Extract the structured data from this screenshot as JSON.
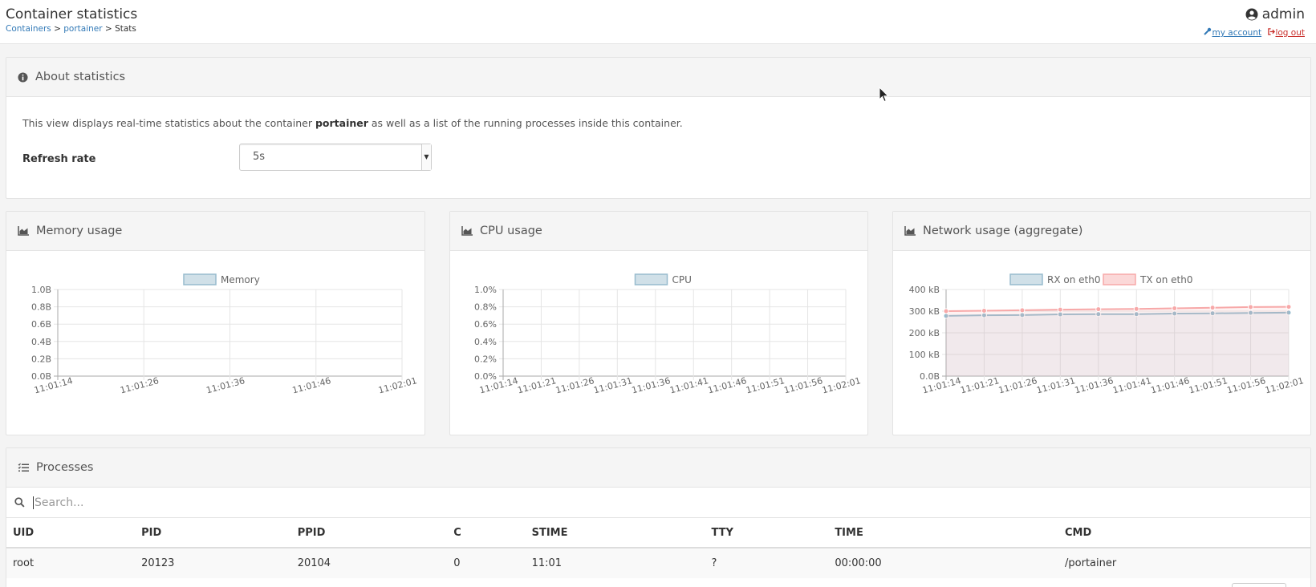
{
  "header": {
    "title": "Container statistics",
    "breadcrumb": {
      "item1": "Containers",
      "sep1": " > ",
      "item2": "portainer",
      "sep2": " > ",
      "current": "Stats"
    },
    "user": "admin",
    "my_account": "my account",
    "log_out": "log out"
  },
  "about": {
    "title": "About statistics",
    "text_prefix": "This view displays real-time statistics about the container ",
    "container_name": "portainer",
    "text_suffix": " as well as a list of the running processes inside this container.",
    "refresh_label": "Refresh rate",
    "refresh_value": "5s"
  },
  "memory": {
    "title": "Memory usage"
  },
  "cpu": {
    "title": "CPU usage"
  },
  "network": {
    "title": "Network usage (aggregate)"
  },
  "chart_data": [
    {
      "type": "line",
      "legend": [
        "Memory"
      ],
      "y_ticks": [
        "1.0B",
        "0.8B",
        "0.6B",
        "0.4B",
        "0.2B",
        "0.0B"
      ],
      "ylim": [
        0,
        1
      ],
      "x_ticks": [
        "11:01:14",
        "11:01:26",
        "11:01:36",
        "11:01:46",
        "11:02:01"
      ],
      "series": [
        {
          "name": "Memory",
          "values": [],
          "color": "#97bbcd"
        }
      ],
      "grid": true,
      "legend_position": "top"
    },
    {
      "type": "line",
      "legend": [
        "CPU"
      ],
      "y_ticks": [
        "1.0%",
        "0.8%",
        "0.6%",
        "0.4%",
        "0.2%",
        "0.0%"
      ],
      "ylim": [
        0,
        1
      ],
      "x_ticks": [
        "11:01:14",
        "11:01:21",
        "11:01:26",
        "11:01:31",
        "11:01:36",
        "11:01:41",
        "11:01:46",
        "11:01:51",
        "11:01:56",
        "11:02:01"
      ],
      "series": [
        {
          "name": "CPU",
          "values": [],
          "color": "#97bbcd"
        }
      ],
      "grid": true,
      "legend_position": "top"
    },
    {
      "type": "line",
      "legend": [
        "RX on eth0",
        "TX on eth0"
      ],
      "y_ticks": [
        "400 kB",
        "300 kB",
        "200 kB",
        "100 kB",
        "0.0B"
      ],
      "ylim": [
        0,
        400
      ],
      "x": [
        "11:01:14",
        "11:01:21",
        "11:01:26",
        "11:01:31",
        "11:01:36",
        "11:01:41",
        "11:01:46",
        "11:01:51",
        "11:01:56",
        "11:02:01"
      ],
      "series": [
        {
          "name": "RX on eth0",
          "values": [
            278,
            281,
            282,
            285,
            286,
            286,
            289,
            290,
            292,
            293
          ],
          "color": "#97bbcd"
        },
        {
          "name": "TX on eth0",
          "values": [
            300,
            302,
            304,
            307,
            309,
            310,
            313,
            316,
            319,
            320
          ],
          "color": "#f7a8a8"
        }
      ],
      "grid": true,
      "legend_position": "top"
    }
  ],
  "processes": {
    "title": "Processes",
    "search_placeholder": "Search...",
    "columns": [
      "UID",
      "PID",
      "PPID",
      "C",
      "STIME",
      "TTY",
      "TIME",
      "CMD"
    ],
    "rows": [
      [
        "root",
        "20123",
        "20104",
        "0",
        "11:01",
        "?",
        "00:00:00",
        "/portainer"
      ]
    ]
  }
}
